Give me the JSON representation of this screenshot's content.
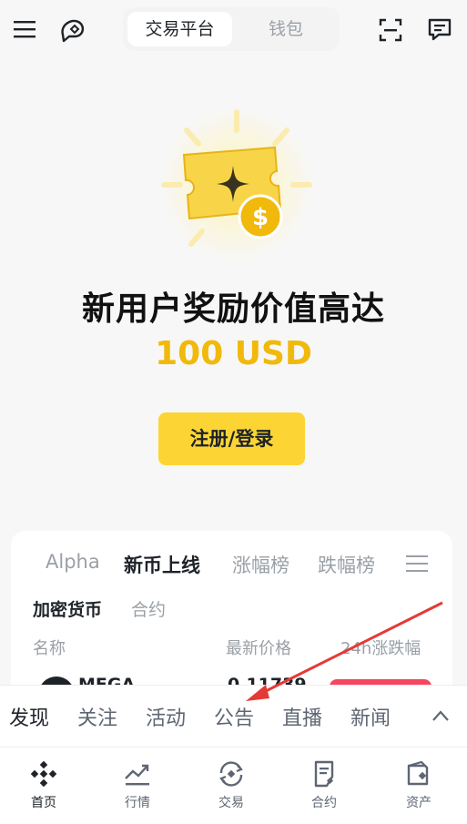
{
  "header": {
    "tab_exchange": "交易平台",
    "tab_wallet": "钱包"
  },
  "hero": {
    "headline": "新用户奖励价值高达",
    "amount": "100 USD",
    "cta_label": "注册/登录"
  },
  "market": {
    "tabs": [
      "Alpha",
      "新币上线",
      "涨幅榜",
      "跌幅榜"
    ],
    "active_tab": "新币上线",
    "subtabs": [
      "加密货币",
      "合约"
    ],
    "columns": [
      "名称",
      "最新价格",
      "24h涨跌幅"
    ],
    "rows": [
      {
        "name": "MEGA",
        "price": "0.11739",
        "change_color": "#f6465d"
      }
    ]
  },
  "feed": {
    "tabs": [
      "发现",
      "关注",
      "活动",
      "公告",
      "直播",
      "新闻"
    ],
    "active_tab": "发现"
  },
  "bottom_nav": {
    "items": [
      "首页",
      "行情",
      "交易",
      "合约",
      "资产"
    ],
    "active": "首页"
  },
  "colors": {
    "accent": "#fcd535",
    "amount": "#f0b90b",
    "annotation_arrow": "#e53935"
  }
}
